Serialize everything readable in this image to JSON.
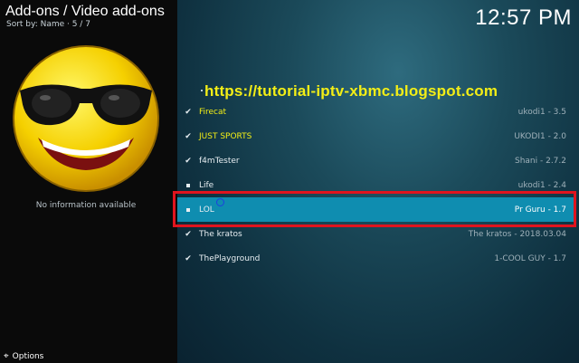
{
  "header": {
    "breadcrumb": "Add-ons / Video add-ons",
    "sort_info": "Sort by: Name  ·  5 / 7",
    "clock": "12:57 PM"
  },
  "sidebar": {
    "no_info": "No information available",
    "options_label": "Options",
    "options_icon": "options-icon"
  },
  "watermark": "https://tutorial-iptv-xbmc.blogspot.com",
  "addons": [
    {
      "name": "Firecat",
      "version": "ukodi1 - 3.5",
      "status": "check",
      "highlight": "yellow"
    },
    {
      "name": "JUST SPORTS",
      "version": "UKODI1 - 2.0",
      "status": "check",
      "highlight": "yellow"
    },
    {
      "name": "f4mTester",
      "version": "Shani - 2.7.2",
      "status": "check"
    },
    {
      "name": "Life",
      "version": "ukodi1 - 2.4",
      "status": "square"
    },
    {
      "name": "LOL",
      "version": "Pr Guru - 1.7",
      "status": "square",
      "selected": true
    },
    {
      "name": "The kratos",
      "version": "The kratos - 2018.03.04",
      "status": "check"
    },
    {
      "name": "ThePlayground",
      "version": "1-COOL GUY - 1.7",
      "status": "check"
    }
  ],
  "colors": {
    "selected_row": "#0f8db0",
    "highlight_box": "#e0141e",
    "watermark_text": "#f3ee16"
  }
}
